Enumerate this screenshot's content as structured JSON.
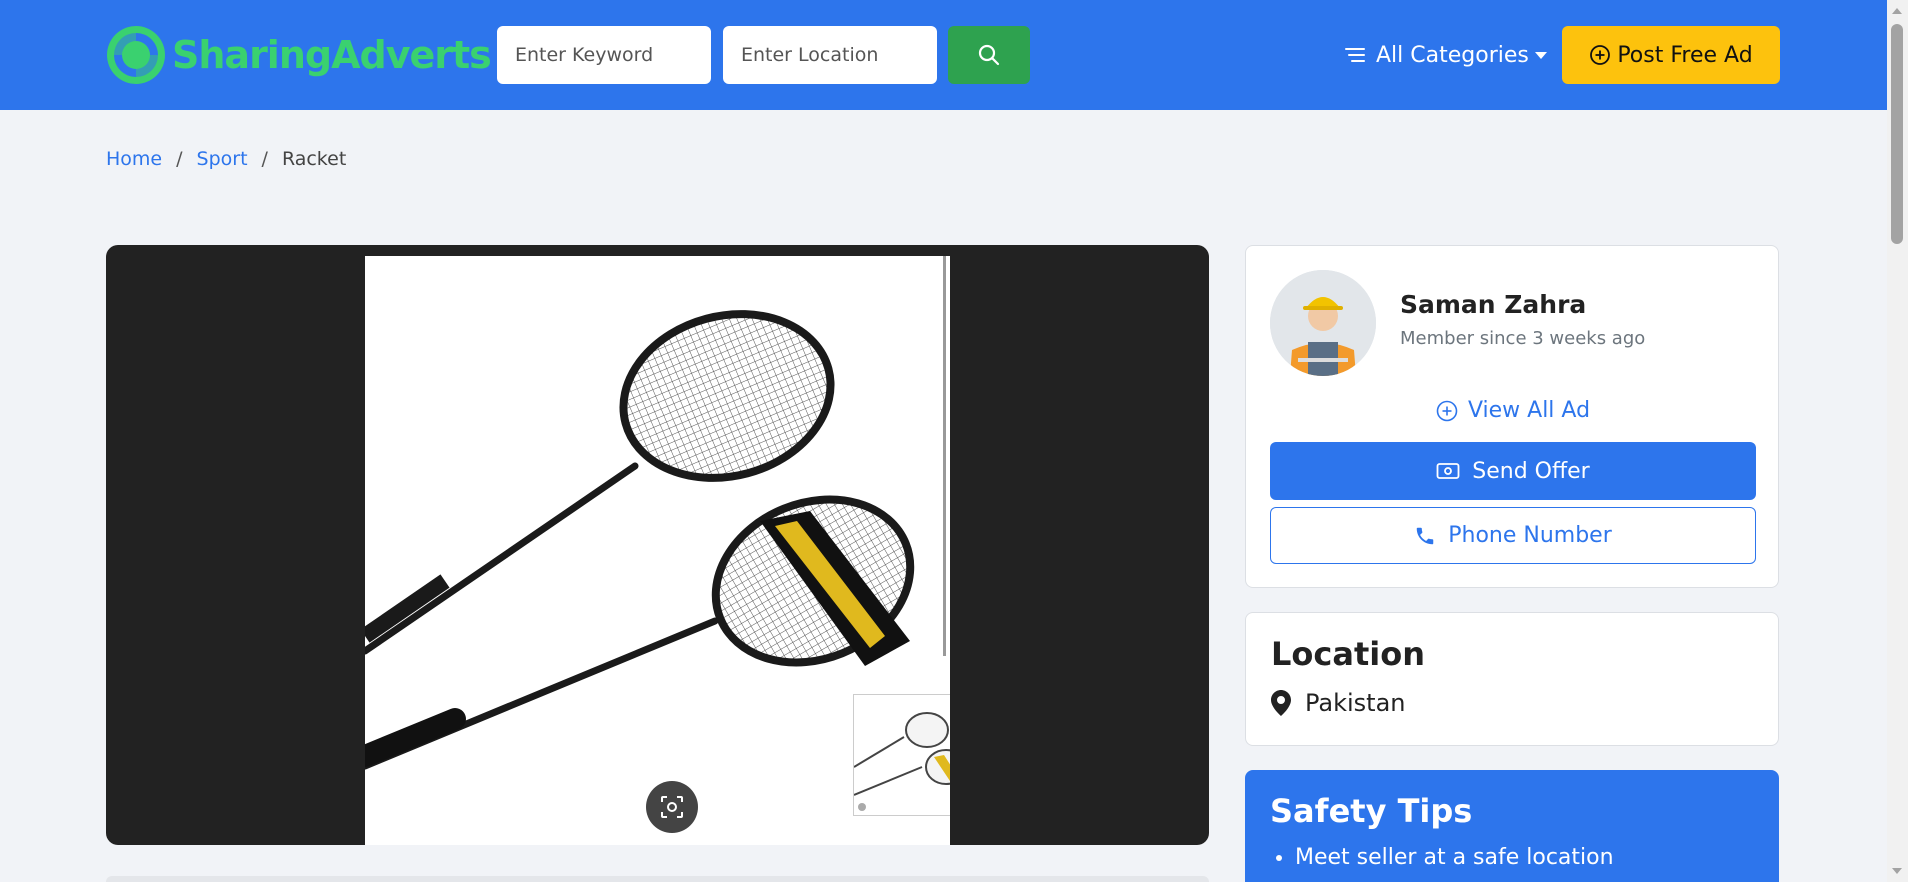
{
  "header": {
    "logo_part1": "Sharing",
    "logo_part2": "Adverts",
    "keyword_placeholder": "Enter Keyword",
    "location_placeholder": "Enter Location",
    "categories_label": "All Categories",
    "post_ad_label": "Post Free Ad"
  },
  "breadcrumb": {
    "items": [
      "Home",
      "Sport"
    ],
    "current": "Racket",
    "separator": "/"
  },
  "seller": {
    "name": "Saman Zahra",
    "member_since": "Member since 3 weeks ago",
    "view_all_label": "View All Ad",
    "send_offer_label": "Send Offer",
    "phone_label": "Phone Number"
  },
  "location": {
    "title": "Location",
    "value": "Pakistan"
  },
  "safety": {
    "title": "Safety Tips",
    "tips": [
      "Meet seller at a safe location"
    ]
  },
  "colors": {
    "brand_blue": "#2d75ec",
    "logo_green": "#3ad16f",
    "search_green": "#2ea24f",
    "post_yellow": "#fdc20d"
  },
  "icons": [
    "logo-icon",
    "search-icon",
    "menu-lines-icon",
    "plus-circle-icon",
    "money-icon",
    "phone-icon",
    "map-pin-icon",
    "lens-icon"
  ]
}
